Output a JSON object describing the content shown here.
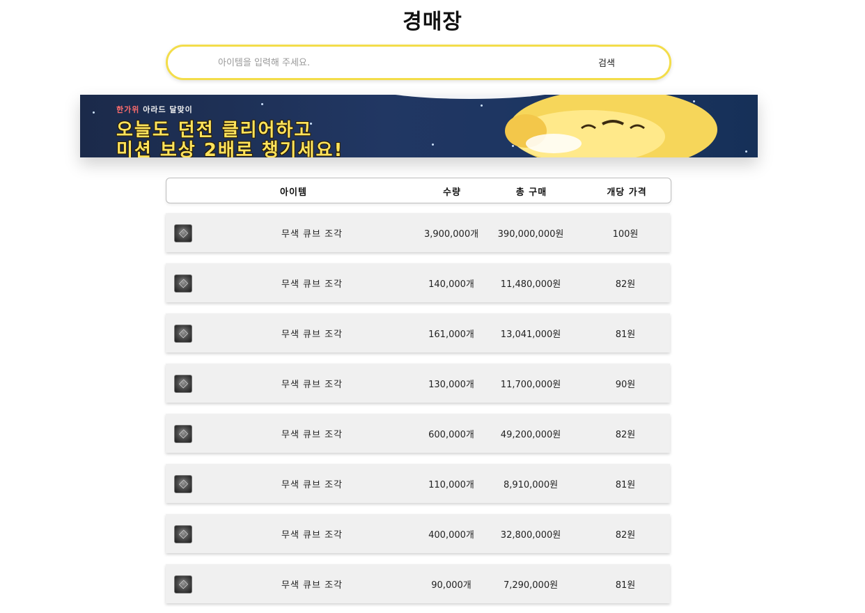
{
  "title": "경매장",
  "search": {
    "placeholder": "아이템을 입력해 주세요.",
    "value": "",
    "button_label": "검색",
    "border_color": "#f3dd4a"
  },
  "banner": {
    "eyebrow_part1": "한가위",
    "eyebrow_part2": " 아라드 달맞이",
    "line1": "오늘도 던전 클리어하고",
    "line2": "미션 보상 2배로 챙기세요!"
  },
  "table": {
    "columns": [
      "아이템",
      "수량",
      "총 구매",
      "개당 가격"
    ],
    "rows": [
      {
        "icon": "colorless-cube-fragment-icon",
        "name": "무색 큐브 조각",
        "qty": "3,900,000개",
        "total": "390,000,000원",
        "unit": "100원"
      },
      {
        "icon": "colorless-cube-fragment-icon",
        "name": "무색 큐브 조각",
        "qty": "140,000개",
        "total": "11,480,000원",
        "unit": "82원"
      },
      {
        "icon": "colorless-cube-fragment-icon",
        "name": "무색 큐브 조각",
        "qty": "161,000개",
        "total": "13,041,000원",
        "unit": "81원"
      },
      {
        "icon": "colorless-cube-fragment-icon",
        "name": "무색 큐브 조각",
        "qty": "130,000개",
        "total": "11,700,000원",
        "unit": "90원"
      },
      {
        "icon": "colorless-cube-fragment-icon",
        "name": "무색 큐브 조각",
        "qty": "600,000개",
        "total": "49,200,000원",
        "unit": "82원"
      },
      {
        "icon": "colorless-cube-fragment-icon",
        "name": "무색 큐브 조각",
        "qty": "110,000개",
        "total": "8,910,000원",
        "unit": "81원"
      },
      {
        "icon": "colorless-cube-fragment-icon",
        "name": "무색 큐브 조각",
        "qty": "400,000개",
        "total": "32,800,000원",
        "unit": "82원"
      },
      {
        "icon": "colorless-cube-fragment-icon",
        "name": "무색 큐브 조각",
        "qty": "90,000개",
        "total": "7,290,000원",
        "unit": "81원"
      }
    ]
  }
}
